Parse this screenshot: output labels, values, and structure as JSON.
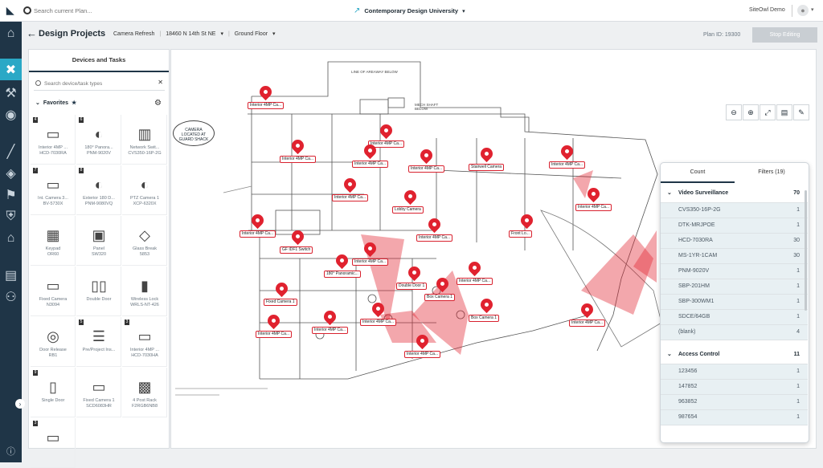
{
  "topbar": {
    "search_placeholder": "Search current Plan...",
    "project_name": "Contemporary Design University",
    "account": "SiteOwl Demo"
  },
  "header": {
    "title": "Design Projects",
    "breadcrumb": [
      "Camera Refresh",
      "18460 N 14th St NE",
      "Ground Floor"
    ],
    "plan_id": "Plan ID: 19300",
    "stop_editing": "Stop Editing"
  },
  "left_panel": {
    "title": "Devices and Tasks",
    "search_placeholder": "Search device/task types",
    "favorites_label": "Favorites",
    "tiles": [
      {
        "num": "4",
        "name": "Interior 4MP ...",
        "model": "HCD-7030RA",
        "icon": "camera-icon"
      },
      {
        "num": "6",
        "name": "180° Panora...",
        "model": "PNM-9020V",
        "icon": "ptz-camera-icon"
      },
      {
        "num": "",
        "name": "Network Swit...",
        "model": "CVS350-16P-2G",
        "icon": "network-switch-icon"
      },
      {
        "num": "7",
        "name": "Int. Camera 3...",
        "model": "BV-5730X",
        "icon": "camera-icon"
      },
      {
        "num": "8",
        "name": "Exterior 180 D...",
        "model": "PNM-9080VQ",
        "icon": "ptz-camera-icon"
      },
      {
        "num": "",
        "name": "PTZ Camera 1",
        "model": "XCP-6320X",
        "icon": "ptz-camera-icon"
      },
      {
        "num": "",
        "name": "Keypad",
        "model": "OR60",
        "icon": "keypad-icon"
      },
      {
        "num": "",
        "name": "Panel",
        "model": "SW320",
        "icon": "panel-icon"
      },
      {
        "num": "",
        "name": "Glass Break",
        "model": "5853",
        "icon": "glass-break-icon"
      },
      {
        "num": "",
        "name": "Fixed Camera",
        "model": "N3094",
        "icon": "camera-icon"
      },
      {
        "num": "",
        "name": "Double Door",
        "model": "",
        "icon": "double-door-icon"
      },
      {
        "num": "",
        "name": "Wireless Lock",
        "model": "WRLS-NT-426",
        "icon": "lock-icon"
      },
      {
        "num": "",
        "name": "Door Release",
        "model": "RB1",
        "icon": "door-release-icon"
      },
      {
        "num": "5",
        "name": "Pre/Project Ins...",
        "model": "",
        "icon": "checklist-icon"
      },
      {
        "num": "3",
        "name": "Interior 4MP ...",
        "model": "HCD-7030HA",
        "icon": "camera-icon"
      },
      {
        "num": "9",
        "name": "Single Door",
        "model": "",
        "icon": "single-door-icon"
      },
      {
        "num": "",
        "name": "Fixed Camera 1",
        "model": "SCD6083HR",
        "icon": "camera-icon"
      },
      {
        "num": "",
        "name": "4 Post Rack",
        "model": "F2RGB6NB8",
        "icon": "rack-icon"
      },
      {
        "num": "3",
        "name": "",
        "model": "",
        "icon": "camera-icon"
      }
    ]
  },
  "map": {
    "labels": {
      "area": "LINE OF AREAWAY BELOW",
      "mech": "MECH SHAFT BELOW",
      "guard": "CAMERA LOCATED AT GUARD SHACK"
    },
    "device_tags": [
      "Interior 4MP Ca...",
      "Interior 4MP Ca...",
      "Interior 4MP Ca...",
      "Interior 4MP Ca...",
      "Interior 4MP Ca...",
      "Stairwell Camera",
      "Interior 4MP Ca...",
      "Interior 4MP Ca...",
      "Lobby Camera",
      "Interior 4MP Ca...",
      "Interior 4MP Ca...",
      "GF IDF1 Switch",
      "Interior 4MP Ca...",
      "180° Panoramic...",
      "Interior 4MP Ca...",
      "Front Lo...",
      "Interior 4MP Ca...",
      "Fixed Camera 1",
      "Box Camera 1",
      "Interior 4MP Ca...",
      "Double Door 1",
      "Interior 4MP Ca...",
      "Interior 4MP Ca...",
      "Box Camera 1",
      "Interior 4MP Ca...",
      "Interior 4MP Ca..."
    ]
  },
  "counts_panel": {
    "tabs": [
      "Count",
      "Filters (19)"
    ],
    "groups": [
      {
        "name": "Video Surveillance",
        "total": "70",
        "rows": [
          {
            "k": "CVS350-16P-2G",
            "n": "1"
          },
          {
            "k": "DTK-MRJPOE",
            "n": "1"
          },
          {
            "k": "HCD-7030RA",
            "n": "30"
          },
          {
            "k": "MS-1YR-1CAM",
            "n": "30"
          },
          {
            "k": "PNM-9020V",
            "n": "1"
          },
          {
            "k": "SBP-201HM",
            "n": "1"
          },
          {
            "k": "SBP-300WM1",
            "n": "1"
          },
          {
            "k": "SDCE/64GB",
            "n": "1"
          },
          {
            "k": "(blank)",
            "n": "4"
          }
        ]
      },
      {
        "name": "Access Control",
        "total": "11",
        "rows": [
          {
            "k": "123456",
            "n": "1"
          },
          {
            "k": "147852",
            "n": "1"
          },
          {
            "k": "963852",
            "n": "1"
          },
          {
            "k": "987654",
            "n": "1"
          }
        ]
      }
    ]
  },
  "colors": {
    "accent": "#2aa8c6",
    "rail": "#1f3547",
    "device": "#e0222f"
  }
}
